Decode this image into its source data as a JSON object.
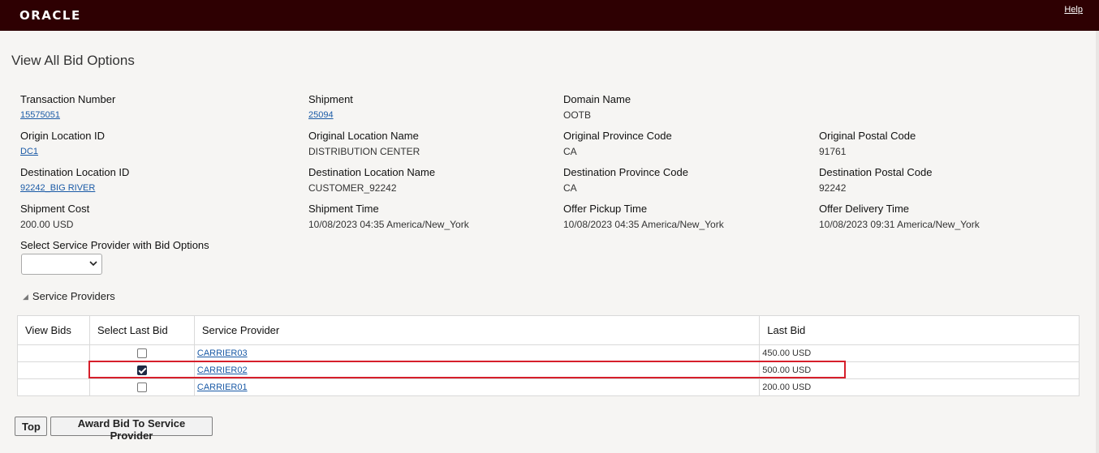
{
  "header": {
    "logo": "ORACLE",
    "help": "Help"
  },
  "page_title": "View All Bid Options",
  "fields": {
    "transaction_number": {
      "label": "Transaction Number",
      "value": "15575051"
    },
    "shipment": {
      "label": "Shipment",
      "value": "25094"
    },
    "domain_name": {
      "label": "Domain Name",
      "value": "OOTB"
    },
    "origin_location_id": {
      "label": "Origin Location ID",
      "value": "DC1"
    },
    "original_location_name": {
      "label": "Original Location Name",
      "value": "DISTRIBUTION CENTER"
    },
    "original_province_code": {
      "label": "Original Province Code",
      "value": "CA"
    },
    "original_postal_code": {
      "label": "Original Postal Code",
      "value": "91761"
    },
    "destination_location_id": {
      "label": "Destination Location ID",
      "value": "92242_BIG RIVER"
    },
    "destination_location_name": {
      "label": "Destination Location Name",
      "value": "CUSTOMER_92242"
    },
    "destination_province_code": {
      "label": "Destination Province Code",
      "value": "CA"
    },
    "destination_postal_code": {
      "label": "Destination Postal Code",
      "value": "92242"
    },
    "shipment_cost": {
      "label": "Shipment Cost",
      "value": "200.00 USD"
    },
    "shipment_time": {
      "label": "Shipment Time",
      "value": "10/08/2023 04:35 America/New_York"
    },
    "offer_pickup_time": {
      "label": "Offer Pickup Time",
      "value": "10/08/2023 04:35 America/New_York"
    },
    "offer_delivery_time": {
      "label": "Offer Delivery Time",
      "value": "10/08/2023 09:31 America/New_York"
    },
    "select_sp": {
      "label": "Select Service Provider with Bid Options",
      "value": ""
    }
  },
  "section": {
    "title": "Service Providers"
  },
  "table": {
    "headers": [
      "View Bids",
      "Select Last Bid",
      "Service Provider",
      "Last Bid"
    ],
    "rows": [
      {
        "view_bids": "",
        "selected": false,
        "provider": "CARRIER03",
        "last_bid": "450.00 USD"
      },
      {
        "view_bids": "",
        "selected": true,
        "provider": "CARRIER02",
        "last_bid": "500.00 USD"
      },
      {
        "view_bids": "",
        "selected": false,
        "provider": "CARRIER01",
        "last_bid": "200.00 USD"
      }
    ]
  },
  "buttons": {
    "top": "Top",
    "award": "Award Bid To Service Provider"
  },
  "colors": {
    "header_bg": "#2e0002",
    "link": "#1a5aa6",
    "highlight": "#d61f2b",
    "checkbox_on": "#1d2a44"
  }
}
